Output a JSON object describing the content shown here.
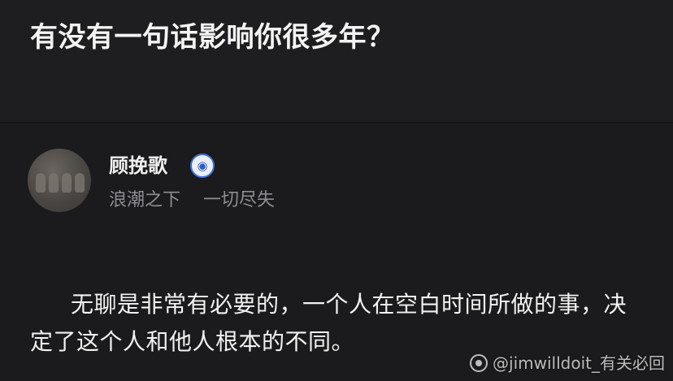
{
  "question": {
    "title": "有没有一句话影响你很多年？"
  },
  "author": {
    "name": "顾挽歌",
    "badge_icon": "panda-badge-icon",
    "bio": "浪潮之下    一切尽失"
  },
  "answer": {
    "text": "无聊是非常有必要的，一个人在空白时间所做的事，决定了这个人和他人根本的不同。"
  },
  "watermark": {
    "text": "@jimwilldoit_有关必回"
  }
}
